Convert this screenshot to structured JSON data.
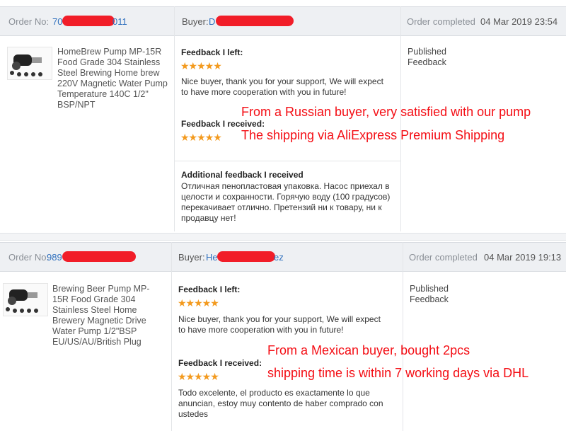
{
  "orders": [
    {
      "order_label": "Order No:",
      "order_no_visible_start": "70",
      "order_no_visible_end": "011",
      "buyer_label": "Buyer:",
      "buyer_visible_start": "D",
      "status_label": "Order completed",
      "status_date": "04 Mar 2019 23:54",
      "product_title": "HomeBrew Pump MP-15R Food Grade 304 Stainless Steel Brewing Home brew 220V Magnetic Water Pump Temperature 140C 1/2\" BSP/NPT",
      "feedback_left_label": "Feedback I left:",
      "feedback_left_stars": "★★★★★",
      "feedback_left_text": "Nice buyer, thank you for your support, We will expect to have more cooperation with you in future!",
      "feedback_received_label": "Feedback I received:",
      "feedback_received_stars": "★★★★★",
      "additional_label": "Additional feedback I received",
      "additional_text": "Отличная пенопластовая упаковка. Насос приехал в целости и сохранности. Горячую воду (100 градусов) перекачивает отлично. Претензий ни к товару, ни к продавцу нет!",
      "published_text": "Published Feedback",
      "annotation_line1": "From a Russian buyer, very satisfied with our pump",
      "annotation_line2": "The shipping via AliExpress Premium Shipping"
    },
    {
      "order_label": "Order No:",
      "order_no_visible_start": "989",
      "buyer_label": "Buyer:",
      "buyer_visible_start": "He",
      "buyer_visible_end": "ez",
      "status_label": "Order completed",
      "status_date": "04 Mar 2019 19:13",
      "product_title": "Brewing Beer Pump MP-15R Food Grade 304 Stainless Steel Home Brewery Magnetic Drive Water Pump 1/2\"BSP EU/US/AU/British Plug",
      "feedback_left_label": "Feedback I left:",
      "feedback_left_stars": "★★★★★",
      "feedback_left_text": "Nice buyer, thank you for your support, We will expect to have more cooperation with you in future!",
      "feedback_received_label": "Feedback I received:",
      "feedback_received_stars": "★★★★★",
      "feedback_received_text": "Todo excelente, el producto es exactamente lo que anuncian, estoy muy contento de haber comprado con ustedes",
      "published_text": "Published Feedback",
      "annotation_line1": "From a Mexican buyer, bought 2pcs",
      "annotation_line2": "shipping time  is  within 7 working days via DHL"
    }
  ],
  "colors": {
    "stars": "#f39a1e",
    "annotation": "#f40d14",
    "link": "#2e6fbd",
    "redaction": "#f11d28"
  }
}
